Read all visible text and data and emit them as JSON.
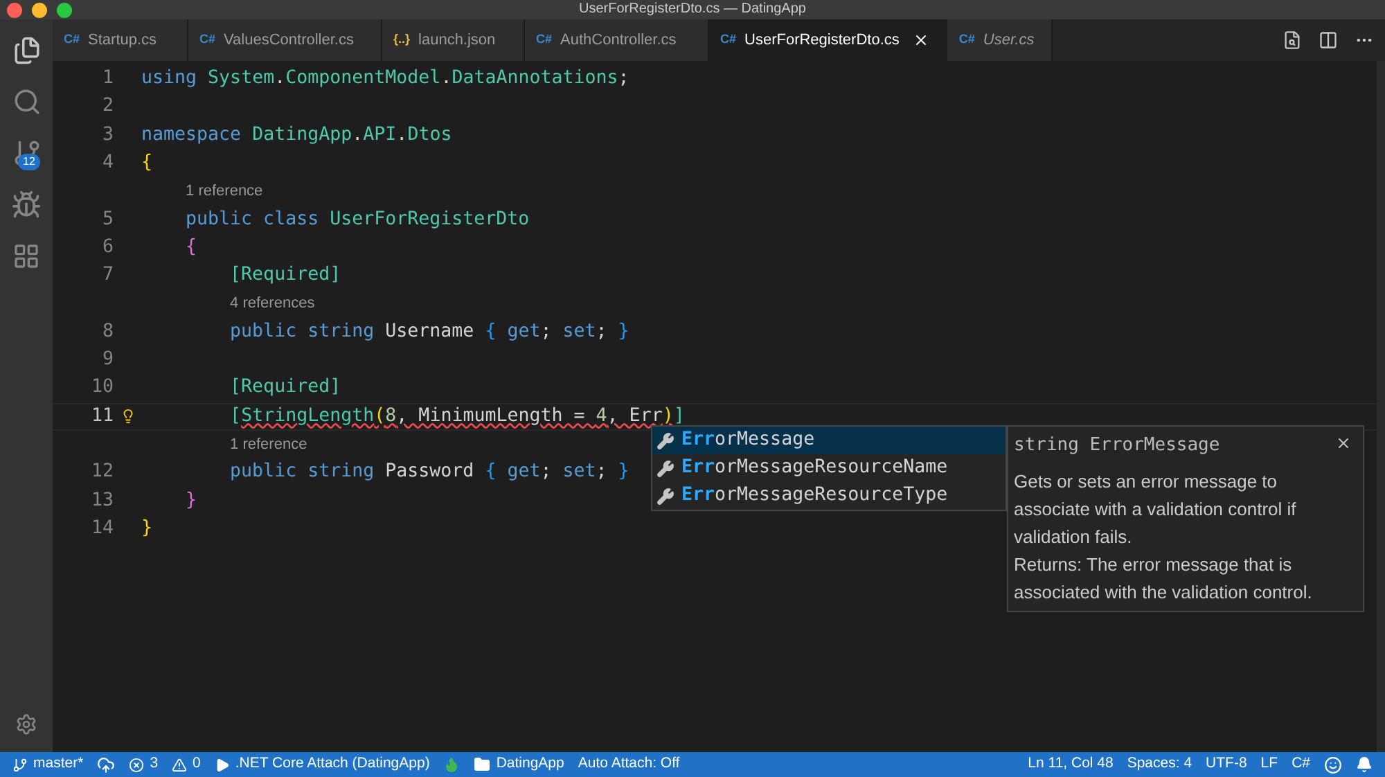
{
  "window": {
    "title": "UserForRegisterDto.cs — DatingApp"
  },
  "activity_bar": {
    "source_control_badge": "12"
  },
  "tabs": [
    {
      "icon": "C#",
      "label": "Startup.cs",
      "selected": false,
      "preview": false
    },
    {
      "icon": "C#",
      "label": "ValuesController.cs",
      "selected": false,
      "preview": false
    },
    {
      "icon": "{..}",
      "label": "launch.json",
      "selected": false,
      "preview": false
    },
    {
      "icon": "C#",
      "label": "AuthController.cs",
      "selected": false,
      "preview": false
    },
    {
      "icon": "C#",
      "label": "UserForRegisterDto.cs",
      "selected": true,
      "preview": false
    },
    {
      "icon": "C#",
      "label": "User.cs",
      "selected": false,
      "preview": true
    }
  ],
  "editor": {
    "lines": [
      {
        "kind": "code",
        "number": "1",
        "current": false,
        "lightbulb": false,
        "tokens": [
          {
            "text": "using ",
            "kind": "keyword"
          },
          {
            "text": "System",
            "kind": "type"
          },
          {
            "text": ".",
            "kind": "plain"
          },
          {
            "text": "ComponentModel",
            "kind": "type"
          },
          {
            "text": ".",
            "kind": "plain"
          },
          {
            "text": "DataAnnotations",
            "kind": "type"
          },
          {
            "text": ";",
            "kind": "plain"
          }
        ]
      },
      {
        "kind": "code",
        "number": "2",
        "current": false,
        "lightbulb": false
      },
      {
        "kind": "code",
        "number": "3",
        "current": false,
        "lightbulb": false,
        "tokens": [
          {
            "text": "namespace ",
            "kind": "keyword"
          },
          {
            "text": "DatingApp",
            "kind": "type"
          },
          {
            "text": ".",
            "kind": "plain"
          },
          {
            "text": "API",
            "kind": "type"
          },
          {
            "text": ".",
            "kind": "plain"
          },
          {
            "text": "Dtos",
            "kind": "type"
          }
        ]
      },
      {
        "kind": "code",
        "number": "4",
        "current": false,
        "lightbulb": false,
        "tokens": [
          {
            "text": "{",
            "kind": "bracket1"
          }
        ]
      },
      {
        "kind": "lens",
        "text": "1 reference"
      },
      {
        "kind": "code",
        "number": "5",
        "current": false,
        "lightbulb": false,
        "tokens": [
          {
            "text": "    public class ",
            "kind": "keyword"
          },
          {
            "text": "UserForRegisterDto",
            "kind": "type"
          }
        ]
      },
      {
        "kind": "code",
        "number": "6",
        "current": false,
        "lightbulb": false,
        "tokens": [
          {
            "text": "    {",
            "kind": "bracket2"
          }
        ]
      },
      {
        "kind": "code",
        "number": "7",
        "current": false,
        "lightbulb": false,
        "tokens": [
          {
            "text": "        [Required]",
            "kind": "type"
          }
        ]
      },
      {
        "kind": "lens",
        "text": "4 references"
      },
      {
        "kind": "code",
        "number": "8",
        "current": false,
        "lightbulb": false,
        "tokens": [
          {
            "text": "        public string",
            "kind": "keyword"
          },
          {
            "text": " Username ",
            "kind": "plain"
          },
          {
            "text": "{ ",
            "kind": "bracket3"
          },
          {
            "text": "get",
            "kind": "keyword"
          },
          {
            "text": "; ",
            "kind": "plain"
          },
          {
            "text": "set",
            "kind": "keyword"
          },
          {
            "text": "; ",
            "kind": "plain"
          },
          {
            "text": "}",
            "kind": "bracket3"
          }
        ]
      },
      {
        "kind": "code",
        "number": "9",
        "current": false,
        "lightbulb": false
      },
      {
        "kind": "code",
        "number": "10",
        "current": false,
        "lightbulb": false,
        "tokens": [
          {
            "text": "        [Required]",
            "kind": "type"
          }
        ]
      },
      {
        "kind": "code",
        "number": "11",
        "current": true,
        "lightbulb": true,
        "tokens": [
          {
            "text": "        [",
            "kind": "type",
            "squiggle": false
          },
          {
            "text": "StringLength",
            "kind": "type",
            "squiggle": true
          },
          {
            "text": "(",
            "kind": "bracket1",
            "squiggle": true
          },
          {
            "text": "8",
            "kind": "number",
            "squiggle": true
          },
          {
            "text": ", MinimumLength = ",
            "kind": "plain",
            "squiggle": true
          },
          {
            "text": "4",
            "kind": "number",
            "squiggle": true
          },
          {
            "text": ", Err",
            "kind": "plain",
            "squiggle": true
          },
          {
            "text": ")",
            "kind": "bracket1",
            "squiggle": true
          },
          {
            "text": "]",
            "kind": "type",
            "squiggle": false
          }
        ]
      },
      {
        "kind": "lens",
        "text": "1 reference"
      },
      {
        "kind": "code",
        "number": "12",
        "current": false,
        "lightbulb": false,
        "tokens": [
          {
            "text": "        public string",
            "kind": "keyword"
          },
          {
            "text": " Password ",
            "kind": "plain"
          },
          {
            "text": "{ ",
            "kind": "bracket3"
          },
          {
            "text": "get",
            "kind": "keyword"
          },
          {
            "text": "; ",
            "kind": "plain"
          },
          {
            "text": "set",
            "kind": "keyword"
          },
          {
            "text": "; ",
            "kind": "plain"
          },
          {
            "text": "}",
            "kind": "bracket3"
          }
        ]
      },
      {
        "kind": "code",
        "number": "13",
        "current": false,
        "lightbulb": false,
        "tokens": [
          {
            "text": "    }",
            "kind": "bracket2"
          }
        ]
      },
      {
        "kind": "code",
        "number": "14",
        "current": false,
        "lightbulb": false,
        "tokens": [
          {
            "text": "}",
            "kind": "bracket1"
          }
        ]
      }
    ]
  },
  "suggestions": [
    {
      "match": "Err",
      "rest": "orMessage",
      "selected": true
    },
    {
      "match": "Err",
      "rest": "orMessageResourceName",
      "selected": false
    },
    {
      "match": "Err",
      "rest": "orMessageResourceType",
      "selected": false
    }
  ],
  "details": {
    "signature": "string ErrorMessage",
    "description": "Gets or sets an error message to associate with a validation control if validation fails.",
    "returns": "Returns: The error message that is associated with the validation control."
  },
  "status_bar": {
    "left": [
      {
        "kind": "branch",
        "text": "master*"
      },
      {
        "kind": "sync"
      },
      {
        "kind": "errors",
        "text": "3"
      },
      {
        "kind": "warnings",
        "text": "0"
      },
      {
        "kind": "debug",
        "text": ".NET Core Attach (DatingApp)"
      },
      {
        "kind": "flame"
      },
      {
        "kind": "folder",
        "text": "DatingApp"
      },
      {
        "kind": "text",
        "text": "Auto Attach: Off"
      }
    ],
    "right": [
      {
        "kind": "text",
        "text": "Ln 11, Col 48"
      },
      {
        "kind": "text",
        "text": "Spaces: 4"
      },
      {
        "kind": "text",
        "text": "UTF-8"
      },
      {
        "kind": "text",
        "text": "LF"
      },
      {
        "kind": "text",
        "text": "C#"
      },
      {
        "kind": "smiley"
      },
      {
        "kind": "bell"
      }
    ]
  }
}
